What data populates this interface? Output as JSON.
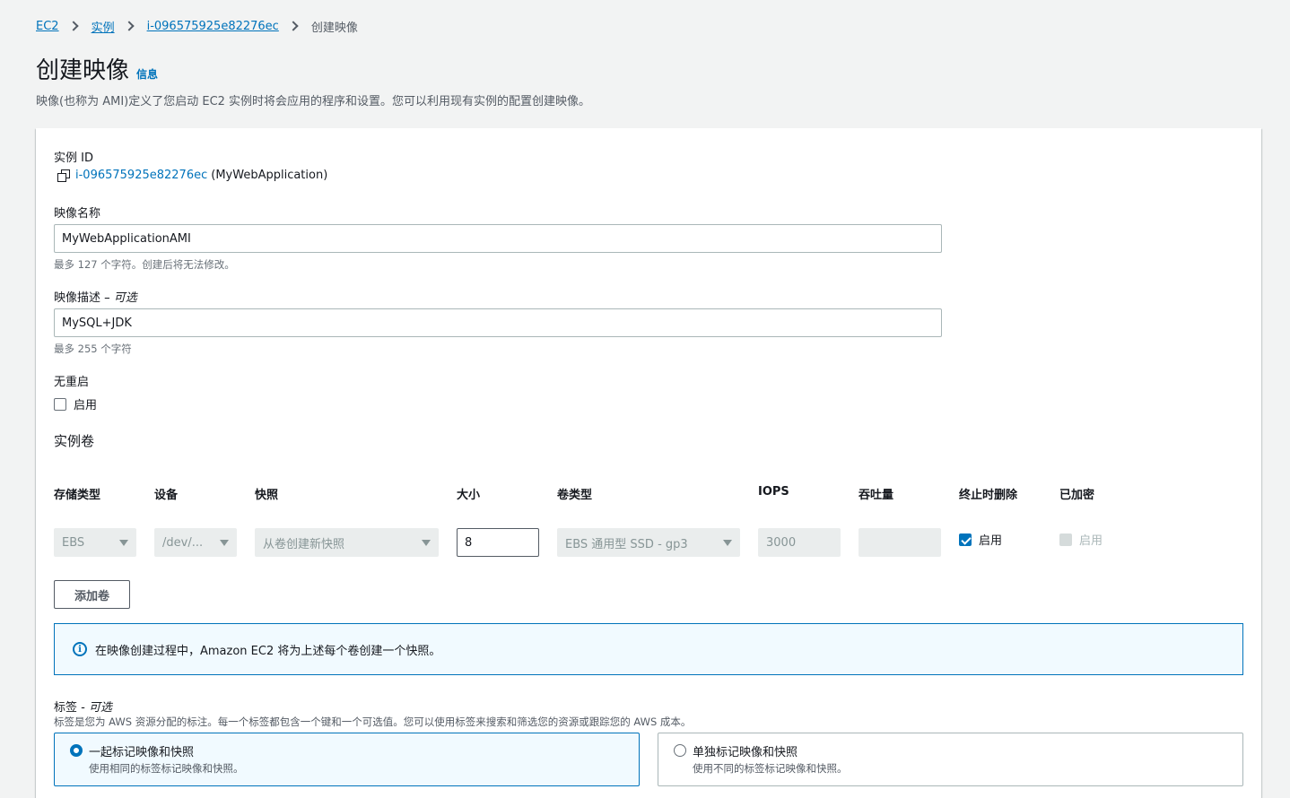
{
  "breadcrumbs": [
    {
      "label": "EC2"
    },
    {
      "label": "实例"
    },
    {
      "label": "i-096575925e82276ec"
    },
    {
      "label": "创建映像"
    }
  ],
  "page": {
    "title": "创建映像",
    "info": "信息",
    "description": "映像(也称为 AMI)定义了您启动 EC2 实例时将会应用的程序和设置。您可以利用现有实例的配置创建映像。"
  },
  "form": {
    "instance_id_label": "实例 ID",
    "instance_id_link": "i-096575925e82276ec",
    "instance_name": "(MyWebApplication)",
    "image_name_label": "映像名称",
    "image_name_value": "MyWebApplicationAMI",
    "image_name_hint": "最多 127 个字符。创建后将无法修改。",
    "image_desc_label": "映像描述",
    "image_desc_optional": "– 可选",
    "image_desc_value": "MySQL+JDK",
    "image_desc_hint": "最多 255 个字符",
    "no_reboot_label": "无重启",
    "no_reboot_checkbox": "启用"
  },
  "volumes": {
    "section_title": "实例卷",
    "headers": [
      "存储类型",
      "设备",
      "快照",
      "大小",
      "卷类型",
      "IOPS",
      "吞吐量",
      "终止时删除",
      "已加密"
    ],
    "row": {
      "storage_type": "EBS",
      "device": "/dev/...",
      "snapshot": "从卷创建新快照",
      "size": "8",
      "volume_type": "EBS 通用型 SSD - gp3",
      "iops": "3000",
      "throughput": "",
      "delete_on_termination": "启用",
      "delete_on_termination_checked": true,
      "encrypted": "启用",
      "encrypted_checked": false
    },
    "add_button": "添加卷"
  },
  "alert": {
    "text": "在映像创建过程中，Amazon EC2 将为上述每个卷创建一个快照。"
  },
  "tags": {
    "label": "标签",
    "optional": "- 可选",
    "description": "标签是您为 AWS 资源分配的标注。每一个标签都包含一个键和一个可选值。您可以使用标签来搜索和筛选您的资源或跟踪您的 AWS 成本。",
    "options": [
      {
        "title": "一起标记映像和快照",
        "desc": "使用相同的标签标记映像和快照。",
        "selected": true
      },
      {
        "title": "单独标记映像和快照",
        "desc": "使用不同的标签标记映像和快照。",
        "selected": false
      }
    ]
  },
  "colors": {
    "link": "#0073bb",
    "background": "#f2f3f3",
    "alert_bg": "#f1faff"
  }
}
